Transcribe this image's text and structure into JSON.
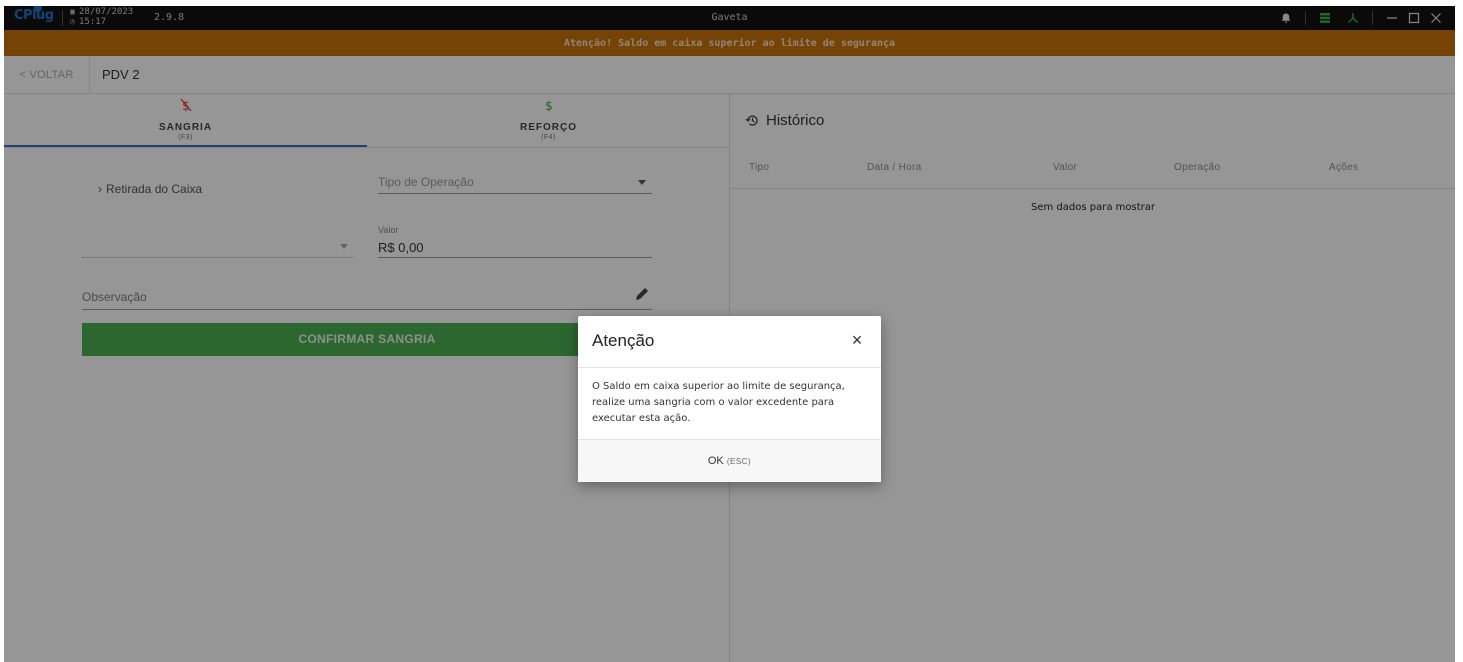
{
  "titlebar": {
    "logo": "CPlug",
    "date": "28/07/2023",
    "time": "15:17",
    "version": "2.9.8",
    "title": "Gaveta"
  },
  "warning": "Atenção! Saldo em caixa superior ao limite de segurança",
  "header": {
    "back_label": "< VOLTAR",
    "page_title": "PDV 2"
  },
  "tabs": [
    {
      "label": "SANGRIA",
      "key": "(F3)",
      "icon": "money-off-icon",
      "color": "#e53935"
    },
    {
      "label": "REFORÇO",
      "key": "(F4)",
      "icon": "dollar-icon",
      "color": "#43a047"
    }
  ],
  "form": {
    "retirada_label": "Retirada do Caixa",
    "tipo_placeholder": "Tipo de Operação",
    "valor_label": "Valor",
    "valor_value": "R$ 0,00",
    "observacao_placeholder": "Observação",
    "confirm_label": "CONFIRMAR SANGRIA"
  },
  "history": {
    "title": "Histórico",
    "columns": [
      "Tipo",
      "Data / Hora",
      "Valor",
      "Operação",
      "Ações"
    ],
    "empty": "Sem dados para mostrar"
  },
  "dialog": {
    "title": "Atenção",
    "close": "×",
    "message": "O Saldo em caixa superior ao limite de segurança, realize uma sangria com o valor excedente para executar esta ação.",
    "ok_label": "OK",
    "ok_key": "(ESC)"
  },
  "colors": {
    "warning_bar": "#c9720d",
    "confirm_button": "#4caf50",
    "active_tab": "#3a6fd0"
  }
}
